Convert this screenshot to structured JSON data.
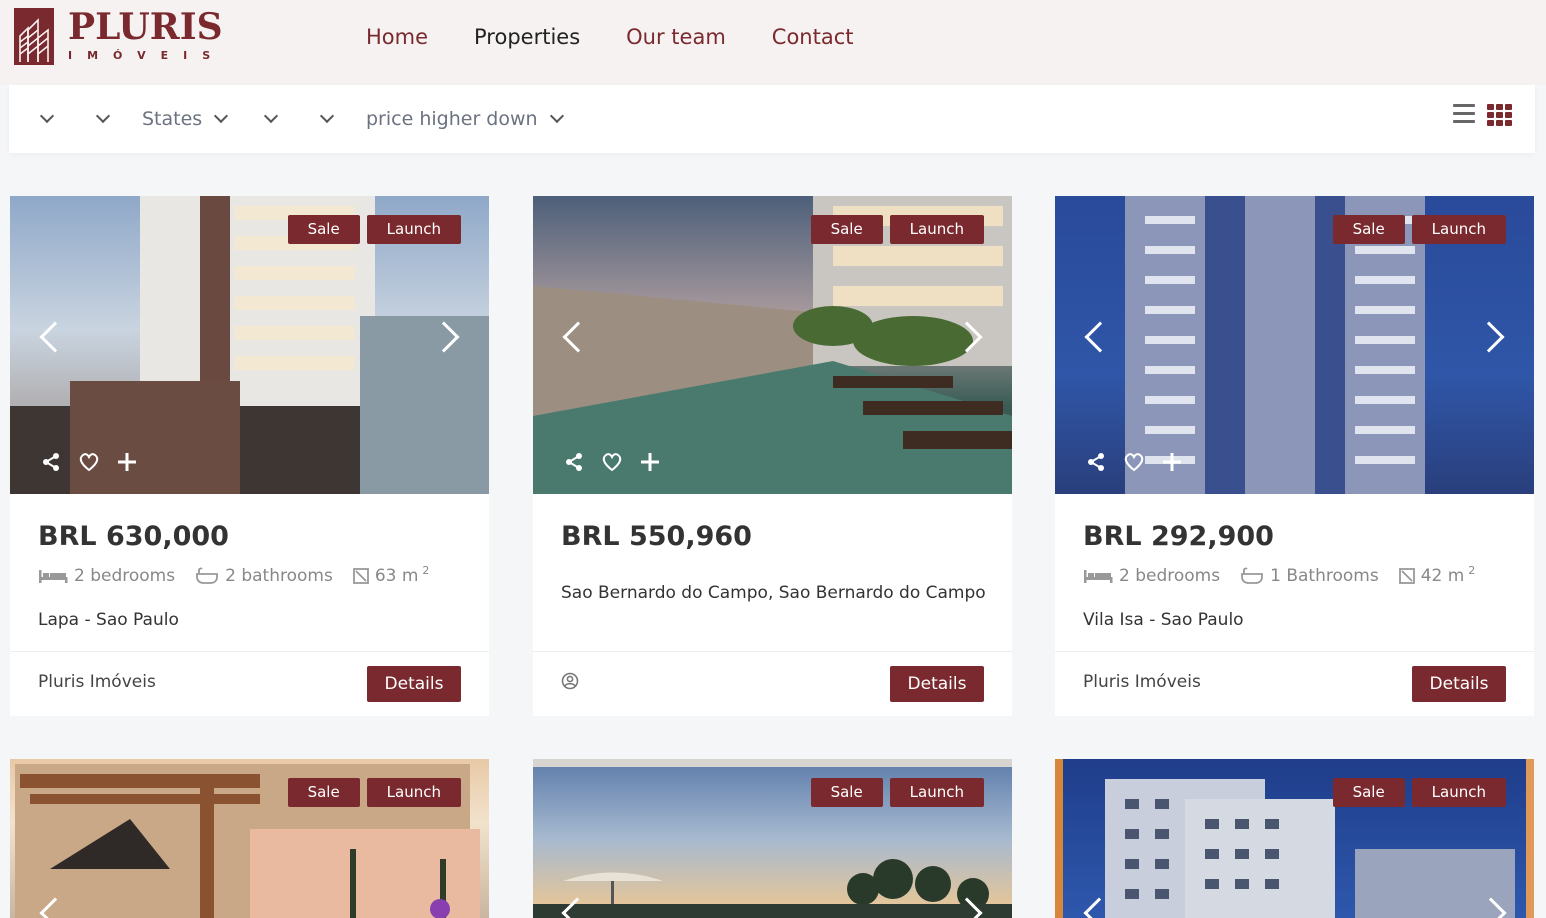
{
  "brand": {
    "name": "PLURIS",
    "subtitle": "IMÓVEIS",
    "color": "#7a2a2e"
  },
  "nav": [
    {
      "label": "Home",
      "active": false
    },
    {
      "label": "Properties",
      "active": true
    },
    {
      "label": "Our team",
      "active": false
    },
    {
      "label": "Contact",
      "active": false
    }
  ],
  "filters": {
    "f1": "",
    "f2": "",
    "states": "States",
    "f4": "",
    "f5": "",
    "sort": "price higher down"
  },
  "view": {
    "list_icon": "list-view-icon",
    "grid_icon": "grid-view-icon",
    "active": "grid"
  },
  "cards": [
    {
      "badges": [
        "Sale",
        "Launch"
      ],
      "price": "BRL 630,000",
      "bedrooms": "2 bedrooms",
      "bathrooms": "2 bathrooms",
      "area": "63 m",
      "area_sup": "2",
      "location": "Lapa - Sao Paulo",
      "agent": "Pluris Imóveis",
      "details": "Details"
    },
    {
      "badges": [
        "Sale",
        "Launch"
      ],
      "price": "BRL 550,960",
      "location": "Sao Bernardo do Campo, Sao Bernardo do Campo",
      "agent": "",
      "details": "Details"
    },
    {
      "badges": [
        "Sale",
        "Launch"
      ],
      "price": "BRL 292,900",
      "bedrooms": "2 bedrooms",
      "bathrooms": "1 Bathrooms",
      "area": "42 m",
      "area_sup": "2",
      "location": "Vila Isa - Sao Paulo",
      "agent": "Pluris Imóveis",
      "details": "Details"
    },
    {
      "badges": [
        "Sale",
        "Launch"
      ]
    },
    {
      "badges": [
        "Sale",
        "Launch"
      ]
    },
    {
      "badges": [
        "Sale",
        "Launch"
      ]
    }
  ]
}
